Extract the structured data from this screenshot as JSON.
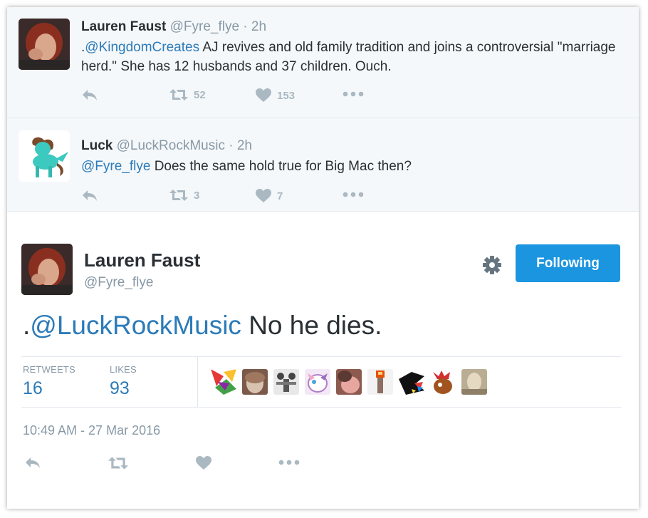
{
  "replies": [
    {
      "name": "Lauren Faust",
      "handle": "@Fyre_flye",
      "time": "· 2h",
      "prefix": ".",
      "mention": "@KingdomCreates",
      "text": " AJ revives and old family tradition and joins a controversial \"marriage herd.\" She has 12 husbands and 37 children. Ouch.",
      "retweets": "52",
      "likes": "153"
    },
    {
      "name": "Luck",
      "handle": "@LuckRockMusic",
      "time": "· 2h",
      "prefix": "",
      "mention": "@Fyre_flye",
      "text": " Does the same hold true for Big Mac then?",
      "retweets": "3",
      "likes": "7"
    }
  ],
  "main": {
    "name": "Lauren Faust",
    "handle": "@Fyre_flye",
    "follow_label": "Following",
    "prefix": ".",
    "mention": "@LuckRockMusic",
    "text": " No he dies.",
    "stats": {
      "retweets_label": "RETWEETS",
      "retweets": "16",
      "likes_label": "LIKES",
      "likes": "93"
    },
    "timestamp": "10:49 AM - 27 Mar 2016"
  },
  "icons": [
    "reply-icon",
    "retweet-icon",
    "heart-icon",
    "more-icon",
    "gear-icon"
  ],
  "colors": {
    "link": "#2b7bb9",
    "follow_button": "#1b95e0",
    "muted": "#8899a6",
    "action": "#aab8c2",
    "reply_bg": "#f5f8fa"
  }
}
